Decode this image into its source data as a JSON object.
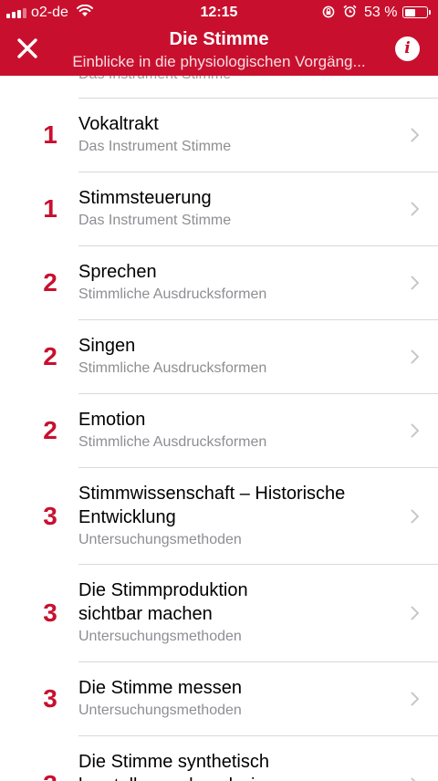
{
  "status_bar": {
    "carrier": "o2-de",
    "time": "12:15",
    "battery_percent": "53 %",
    "battery_level": 0.53,
    "icons": [
      "signal-icon",
      "wifi-icon",
      "rotation-lock-icon",
      "alarm-icon",
      "battery-icon"
    ]
  },
  "header": {
    "title": "Die Stimme",
    "subtitle": "Einblicke in die physiologischen Vorgäng...",
    "close_icon": "close-icon",
    "info_label": "i",
    "background": "#c8102e"
  },
  "list": {
    "partial_top_subtitle": "Das Instrument Stimme",
    "items": [
      {
        "number": "1",
        "title": "Vokaltrakt",
        "subtitle": "Das Instrument Stimme"
      },
      {
        "number": "1",
        "title": "Stimmsteuerung",
        "subtitle": "Das Instrument Stimme"
      },
      {
        "number": "2",
        "title": "Sprechen",
        "subtitle": "Stimmliche Ausdrucksformen"
      },
      {
        "number": "2",
        "title": "Singen",
        "subtitle": "Stimmliche Ausdrucksformen"
      },
      {
        "number": "2",
        "title": "Emotion",
        "subtitle": "Stimmliche Ausdrucksformen"
      },
      {
        "number": "3",
        "title_line1": "Stimmwissenschaft – Historische",
        "title_line2": "Entwicklung",
        "subtitle": "Untersuchungsmethoden"
      },
      {
        "number": "3",
        "title_line1": "Die Stimmproduktion",
        "title_line2": "sichtbar machen",
        "subtitle": "Untersuchungsmethoden"
      },
      {
        "number": "3",
        "title": "Die Stimme messen",
        "subtitle": "Untersuchungsmethoden"
      },
      {
        "number": "3",
        "title_line1": "Die Stimme synthetisch",
        "title_line2": "herstellen und analysieren"
      }
    ]
  }
}
